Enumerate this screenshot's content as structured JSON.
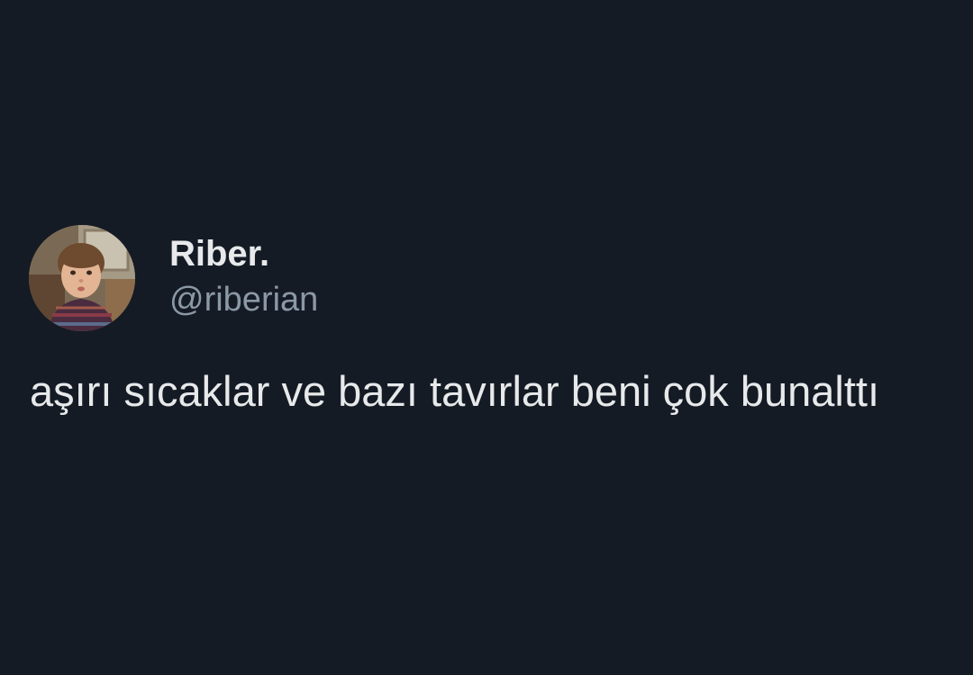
{
  "theme": {
    "background": "#151b25",
    "text_primary": "#e7e9ea",
    "text_secondary": "#8b98a5"
  },
  "tweet": {
    "author": {
      "display_name": "Riber.",
      "handle": "@riberian",
      "avatar_icon": "child-portrait-avatar"
    },
    "text": "aşırı sıcaklar ve bazı tavırlar beni çok bunalttı"
  }
}
